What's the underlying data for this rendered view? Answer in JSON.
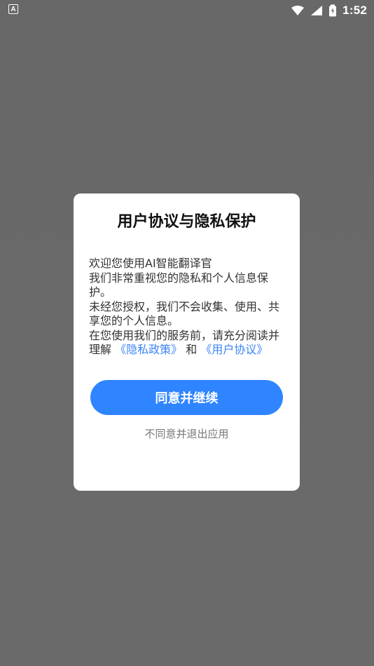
{
  "status_bar": {
    "left_badge": "A",
    "time": "1:52",
    "icons": [
      "wifi-icon",
      "signal-icon",
      "battery-charging-icon"
    ]
  },
  "dialog": {
    "title": "用户协议与隐私保护",
    "body": {
      "line1": "欢迎您使用AI智能翻译官",
      "line2": "我们非常重视您的隐私和个人信息保护。",
      "line3": "未经您授权，我们不会收集、使用、共享您的个人信息。",
      "line4_prefix": "在您使用我们的服务前，请充分阅读并理解",
      "privacy_link": "《隐私政策》",
      "and_text": " 和 ",
      "agreement_link": "《用户协议》"
    },
    "primary_button": "同意并继续",
    "secondary_action": "不同意并退出应用"
  },
  "colors": {
    "backdrop": "#686868",
    "dialog_bg": "#ffffff",
    "primary": "#2f85ff",
    "link": "#3b84f5",
    "text_dark": "#111111",
    "text_body": "#333333",
    "text_muted": "#777777"
  }
}
